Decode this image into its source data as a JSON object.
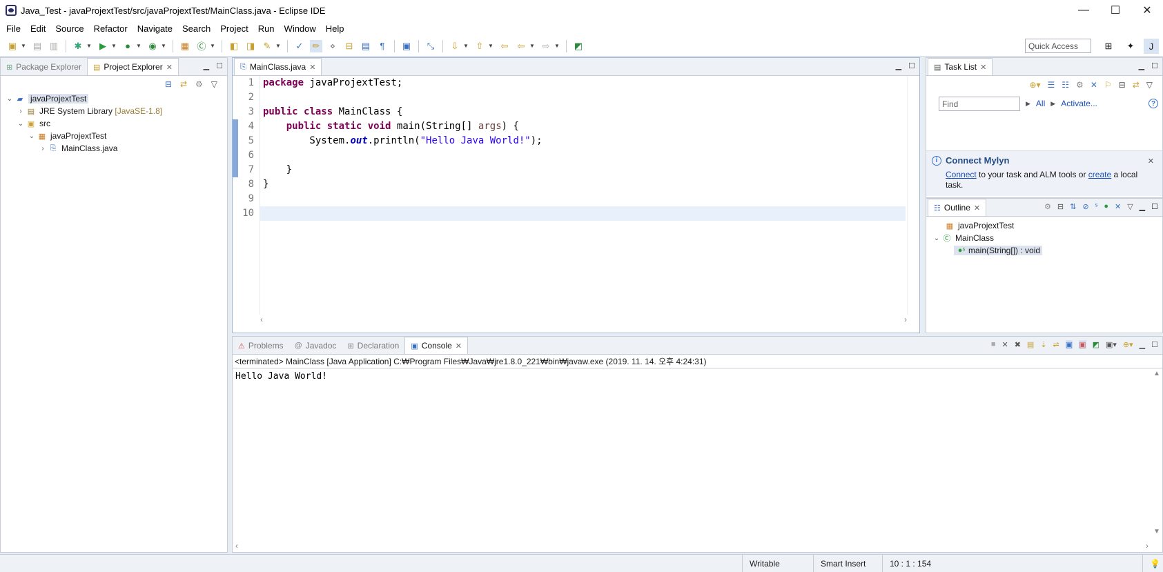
{
  "window": {
    "title": "Java_Test - javaProjextTest/src/javaProjextTest/MainClass.java - Eclipse IDE",
    "controls": [
      "—",
      "☐",
      "✕"
    ]
  },
  "menu": [
    "File",
    "Edit",
    "Source",
    "Refactor",
    "Navigate",
    "Search",
    "Project",
    "Run",
    "Window",
    "Help"
  ],
  "quick_access": {
    "placeholder": "Quick Access"
  },
  "explorer": {
    "tabs": [
      {
        "label": "Package Explorer",
        "active": false
      },
      {
        "label": "Project Explorer",
        "active": true
      }
    ],
    "tree": [
      {
        "label": "javaProjextTest",
        "level": 0,
        "expanded": true,
        "icon": "project-icon"
      },
      {
        "label": "JRE System Library",
        "suffix": "[JavaSE-1.8]",
        "level": 1,
        "expanded": false,
        "icon": "library-icon"
      },
      {
        "label": "src",
        "level": 1,
        "expanded": true,
        "icon": "source-folder-icon"
      },
      {
        "label": "javaProjextTest",
        "level": 2,
        "expanded": true,
        "icon": "package-icon"
      },
      {
        "label": "MainClass.java",
        "level": 3,
        "expanded": false,
        "icon": "java-file-icon"
      }
    ]
  },
  "editor": {
    "tab": "MainClass.java",
    "line_numbers": [
      "1",
      "2",
      "3",
      "4",
      "5",
      "6",
      "7",
      "8",
      "9",
      "10"
    ],
    "current_line": 10
  },
  "tasklist": {
    "tab": "Task List",
    "find_placeholder": "Find",
    "all_label": "All",
    "activate_label": "Activate...",
    "mylyn_title": "Connect Mylyn",
    "mylyn_connect": "Connect",
    "mylyn_text1": " to your task and ALM tools or ",
    "mylyn_create": "create",
    "mylyn_text2": " a local task."
  },
  "outline": {
    "tab": "Outline",
    "items": [
      {
        "label": "javaProjextTest",
        "icon": "package-icon"
      },
      {
        "label": "MainClass",
        "icon": "class-icon"
      },
      {
        "label": "main(String[]) : void",
        "icon": "method-icon"
      }
    ]
  },
  "console": {
    "tabs": [
      {
        "label": "Problems",
        "active": false
      },
      {
        "label": "Javadoc",
        "active": false
      },
      {
        "label": "Declaration",
        "active": false
      },
      {
        "label": "Console",
        "active": true
      }
    ],
    "header": "<terminated> MainClass [Java Application] C:₩Program Files₩Java₩jre1.8.0_221₩bin₩javaw.exe (2019. 11. 14. 오후 4:24:31)",
    "output": "Hello Java World!"
  },
  "status": {
    "writable": "Writable",
    "insert_mode": "Smart Insert",
    "position": "10 : 1 : 154"
  },
  "colors": {
    "keyword": "#7f0055",
    "string": "#2a00ff",
    "field": "#0000c0",
    "link": "#1a50b8"
  }
}
